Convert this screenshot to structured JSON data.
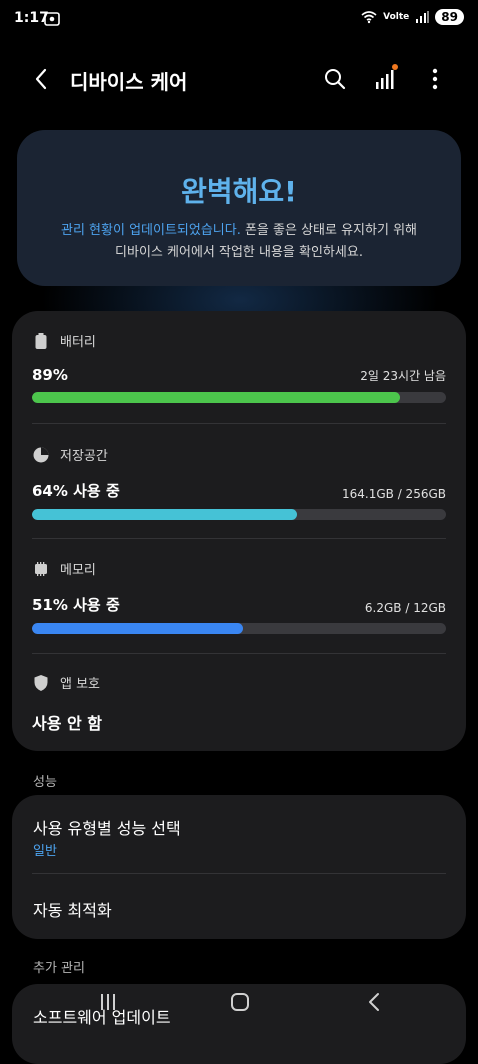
{
  "status_bar": {
    "time": "1:17",
    "network": "Volte",
    "battery": "89"
  },
  "header": {
    "title": "디바이스 케어"
  },
  "summary": {
    "title": "완벽해요!",
    "desc_highlight": "관리 현황이 업데이트되었습니다.",
    "desc_rest_1": " 폰을 좋은 상태로 유지하기 위해",
    "desc_rest_2": "디바이스 케어에서 작업한 내용을 확인하세요."
  },
  "battery": {
    "label": "배터리",
    "value": "89%",
    "right": "2일 23시간 남음",
    "fill_percent": 89,
    "color": "#4cc54c"
  },
  "storage": {
    "label": "저장공간",
    "value": "64% 사용 중",
    "right": "164.1GB / 256GB",
    "fill_percent": 64,
    "color": "#45c2d6"
  },
  "memory": {
    "label": "메모리",
    "value": "51% 사용 중",
    "right": "6.2GB / 12GB",
    "fill_percent": 51,
    "color": "#3a86f2"
  },
  "app_protection": {
    "label": "앱 보호",
    "value": "사용 안 함"
  },
  "performance": {
    "group_label": "성능",
    "items": [
      {
        "title": "사용 유형별 성능 선택",
        "subtitle": "일반"
      },
      {
        "title": "자동 최적화"
      }
    ]
  },
  "extra": {
    "group_label": "추가 관리",
    "first_item": "소프트웨어 업데이트"
  },
  "colors": {
    "accent_blue": "#4da3ef",
    "notification_dot": "#f07820"
  }
}
